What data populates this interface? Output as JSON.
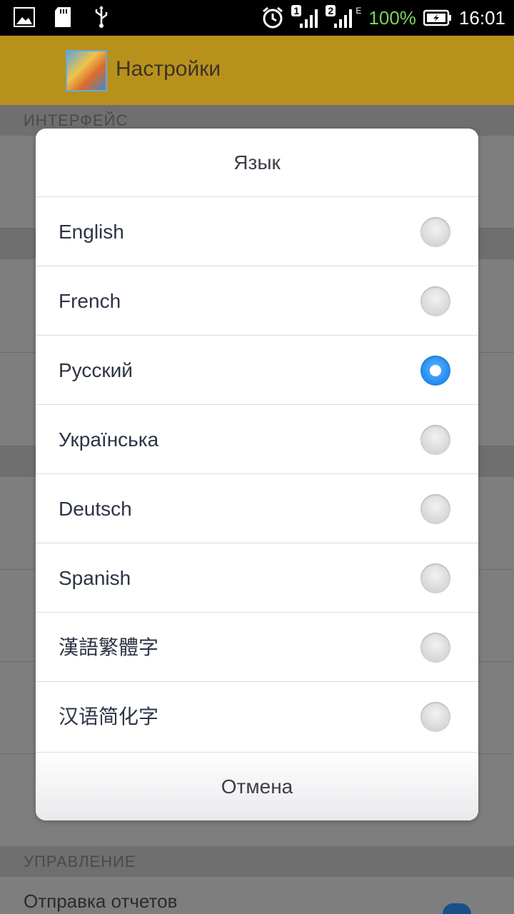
{
  "status_bar": {
    "battery_percent": "100%",
    "time": "16:01",
    "sim1": "1",
    "sim2": "2",
    "network": "E",
    "icons": [
      "gallery-icon",
      "sd-card-icon",
      "usb-icon",
      "alarm-icon",
      "signal-icon",
      "battery-icon"
    ],
    "battery_color": "#7cd35a"
  },
  "app_bar": {
    "title": "Настройки",
    "background_color": "#b8911c"
  },
  "settings": {
    "section_interface": "ИНТЕРФЕЙС",
    "section_management": "УПРАВЛЕНИЕ",
    "report_sending": "Отправка отчетов"
  },
  "dialog": {
    "title": "Язык",
    "options": [
      {
        "label": "English",
        "selected": false
      },
      {
        "label": "French",
        "selected": false
      },
      {
        "label": "Русский",
        "selected": true
      },
      {
        "label": "Українська",
        "selected": false
      },
      {
        "label": "Deutsch",
        "selected": false
      },
      {
        "label": "Spanish",
        "selected": false
      },
      {
        "label": "漢語繁體字",
        "selected": false
      },
      {
        "label": "汉语简化字",
        "selected": false
      }
    ],
    "cancel_label": "Отмена",
    "accent_color": "#1e88f0"
  }
}
